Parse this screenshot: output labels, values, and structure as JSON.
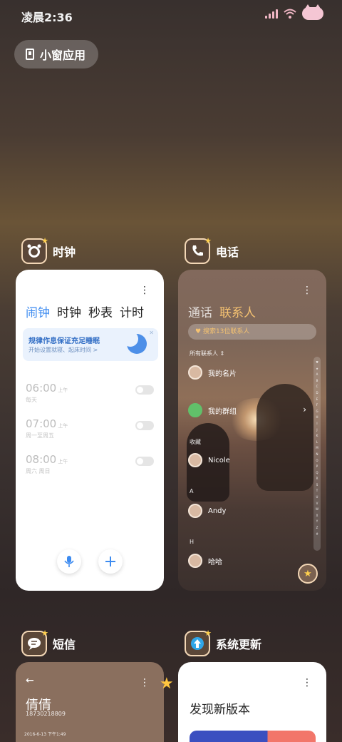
{
  "status": {
    "time": "凌晨2:36"
  },
  "floating_pill": {
    "label": "小窗应用",
    "icon": "small-window-icon"
  },
  "apps": {
    "clock": {
      "name": "时钟",
      "tabs": [
        "闹钟",
        "时钟",
        "秒表",
        "计时"
      ],
      "active_tab": 0,
      "banner": {
        "title": "规律作息保证充足睡眠",
        "subtitle": "开始设置就寝、起床时间 >"
      },
      "alarms": [
        {
          "time": "06:00",
          "ampm": "上午",
          "days": "每天",
          "enabled": false
        },
        {
          "time": "07:00",
          "ampm": "上午",
          "days": "周一至周五",
          "enabled": false
        },
        {
          "time": "08:00",
          "ampm": "上午",
          "days": "周六 周日",
          "enabled": false
        }
      ]
    },
    "phone": {
      "name": "电话",
      "tabs": [
        "通话",
        "联系人"
      ],
      "active_tab": 1,
      "search_placeholder": "搜索13位联系人",
      "all_contacts_label": "所有联系人",
      "contacts": [
        {
          "name": "我的名片"
        },
        {
          "name": "我的群组"
        }
      ],
      "favorites_label": "收藏",
      "favorite": "Nicole",
      "section_a": "A",
      "contact_a": "Andy",
      "section_h": "H",
      "contact_h": "哈哈",
      "alphabet": [
        "♥",
        "★",
        "A",
        "B",
        "C",
        "D",
        "E",
        "F",
        "G",
        "H",
        "I",
        "J",
        "K",
        "L",
        "M",
        "N",
        "O",
        "P",
        "Q",
        "R",
        "S",
        "T",
        "U",
        "V",
        "W",
        "X",
        "Y",
        "Z",
        "#"
      ]
    },
    "sms": {
      "name": "短信",
      "contact_name": "倩倩",
      "number": "18730218809",
      "date": "2016-6-13 下午1:49"
    },
    "update": {
      "name": "系统更新",
      "title": "发现新版本"
    }
  },
  "colors": {
    "accent_blue": "#3d8bf0",
    "accent_gold": "#f5c271"
  }
}
